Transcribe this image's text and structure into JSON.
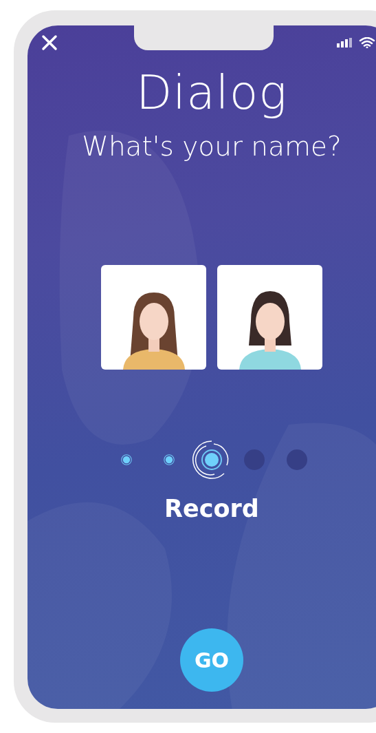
{
  "title": "Dialog",
  "question": "What's your name?",
  "choices": [
    {
      "kind": "long-hair"
    },
    {
      "kind": "bob-hair"
    }
  ],
  "steps": [
    {
      "kind": "done"
    },
    {
      "kind": "done"
    },
    {
      "kind": "current"
    },
    {
      "kind": "pending"
    },
    {
      "kind": "pending"
    }
  ],
  "step_label": "Record",
  "go_button": "GO"
}
